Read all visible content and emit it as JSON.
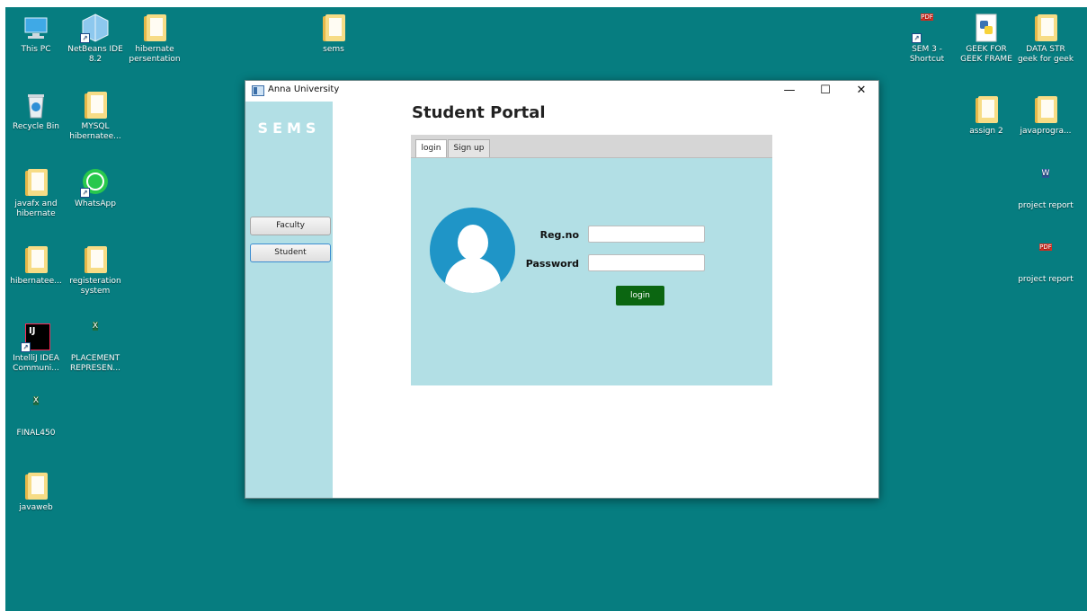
{
  "desktop": {
    "icons": {
      "this_pc": "This PC",
      "netbeans": "NetBeans IDE 8.2",
      "hibernate_presentation": "hibernate persentation",
      "sems_folder": "sems",
      "recycle_bin": "Recycle Bin",
      "mysql": "MYSQL hibernatee...",
      "javafx": "javafx and hibernate",
      "whatsapp": "WhatsApp",
      "hibernatee": "hibernatee...",
      "registeration": "registeration system",
      "intellij": "IntelliJ IDEA Communi...",
      "placement": "PLACEMENT REPRESEN...",
      "final450": "FINAL450",
      "javaweb": "javaweb",
      "sem3": "SEM 3 - Shortcut",
      "geek_frame": "GEEK FOR GEEK FRAME",
      "data_str": "DATA STR geek for geek",
      "assign2": "assign 2",
      "javaprogra": "javaprogra...",
      "project_report_word": "project report",
      "project_report_pdf": "project report"
    },
    "file_tags": {
      "excel": "X",
      "word": "W",
      "pdf": "PDF",
      "intellij": "IJ"
    }
  },
  "window": {
    "title": "Anna University",
    "minimize": "—",
    "maximize": "☐",
    "close": "✕"
  },
  "sidebar": {
    "logo": "SEMS",
    "faculty_label": "Faculty",
    "student_label": "Student"
  },
  "main": {
    "title": "Student Portal",
    "tabs": {
      "login": "login",
      "signup": "Sign up"
    },
    "form": {
      "regno_label": "Reg.no",
      "regno_value": "",
      "password_label": "Password",
      "password_value": "",
      "login_button": "login"
    }
  },
  "colors": {
    "desktop": "#067d80",
    "sidebar": "#b2dfe5",
    "avatar": "#1f95c7",
    "login_button": "#0b6611"
  }
}
